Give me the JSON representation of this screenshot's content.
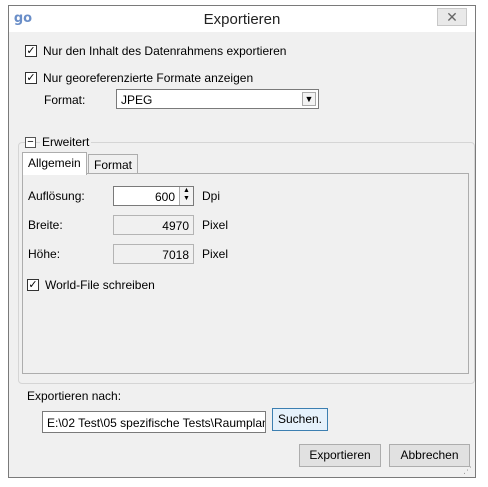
{
  "window": {
    "title": "Exportieren",
    "app_icon": "go-logo-icon",
    "close_label": "✕"
  },
  "options": {
    "only_frame_content": {
      "label": "Nur den Inhalt des Datenrahmens exportieren",
      "checked": true
    },
    "only_georef": {
      "label": "Nur georeferenzierte Formate anzeigen",
      "checked": true
    },
    "format_label": "Format:",
    "format_value": "JPEG"
  },
  "advanced": {
    "label": "Erweitert",
    "expander": "−",
    "tabs": [
      {
        "label": "Allgemein",
        "active": true
      },
      {
        "label": "Format",
        "active": false
      }
    ],
    "resolution": {
      "label": "Auflösung:",
      "value": "600",
      "unit": "Dpi"
    },
    "width": {
      "label": "Breite:",
      "value": "4970",
      "unit": "Pixel"
    },
    "height": {
      "label": "Höhe:",
      "value": "7018",
      "unit": "Pixel"
    },
    "world_file": {
      "label": "World-File schreiben",
      "checked": true
    }
  },
  "export_to": {
    "label": "Exportieren nach:",
    "path": "E:\\02 Test\\05 spezifische Tests\\Raumplan",
    "search_button": "Suchen."
  },
  "buttons": {
    "export": "Exportieren",
    "cancel": "Abbrechen"
  }
}
